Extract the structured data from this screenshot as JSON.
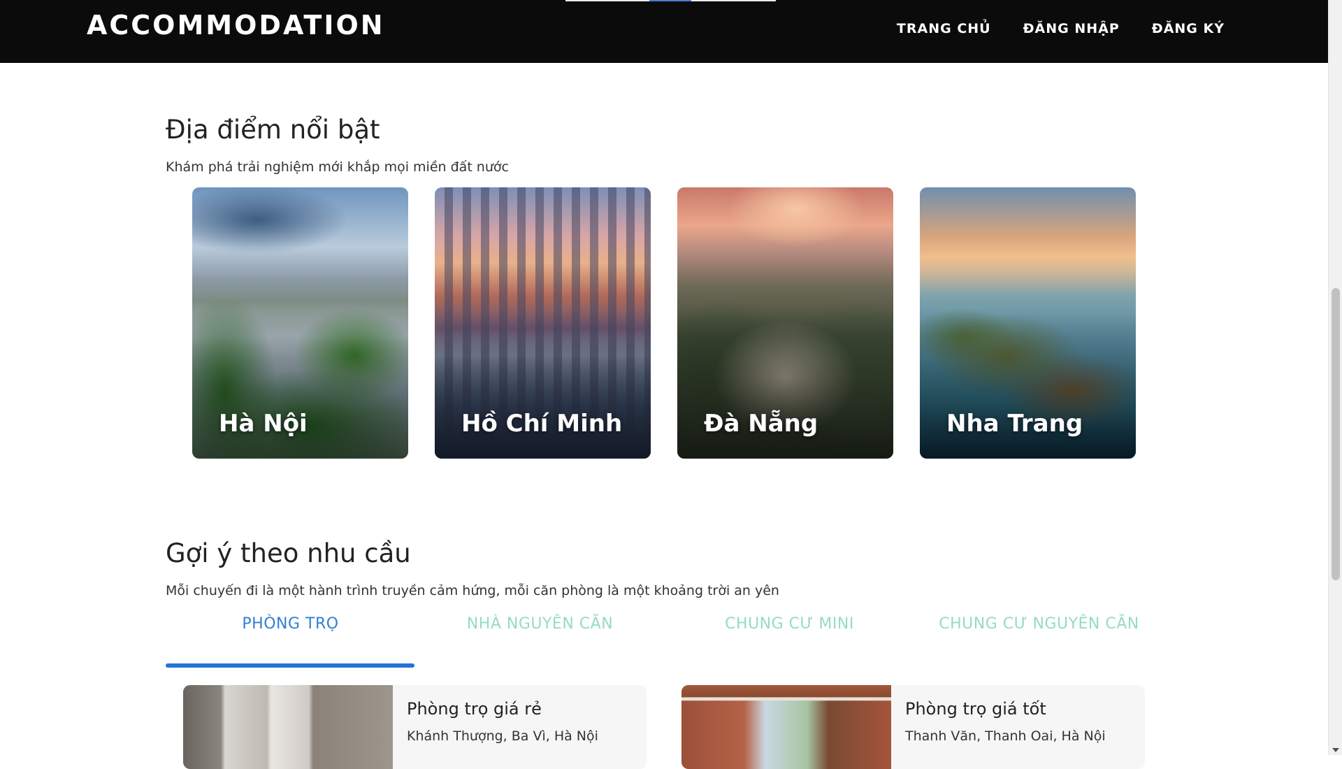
{
  "header": {
    "brand": "ACCOMMODATION",
    "nav": [
      {
        "label": "TRANG CHỦ"
      },
      {
        "label": "ĐĂNG NHẬP"
      },
      {
        "label": "ĐĂNG KÝ"
      }
    ]
  },
  "featured": {
    "title": "Địa điểm nổi bật",
    "subtitle": "Khám phá trải nghiệm mới khắp mọi miền đất nước",
    "destinations": [
      {
        "name": "Hà Nội"
      },
      {
        "name": "Hồ Chí Minh"
      },
      {
        "name": "Đà Nẵng"
      },
      {
        "name": "Nha Trang"
      }
    ]
  },
  "suggestions": {
    "title": "Gợi ý theo nhu cầu",
    "subtitle": "Mỗi chuyến đi là một hành trình truyền cảm hứng, mỗi căn phòng là một khoảng trời an yên",
    "tabs": [
      {
        "label": "PHÒNG TRỌ",
        "active": true
      },
      {
        "label": "NHÀ NGUYÊN CĂN",
        "active": false
      },
      {
        "label": "CHUNG CƯ MINI",
        "active": false
      },
      {
        "label": "CHUNG CƯ NGUYÊN CĂN",
        "active": false
      }
    ],
    "listings": [
      {
        "title": "Phòng trọ giá rẻ",
        "address": "Khánh Thượng, Ba Vì, Hà Nội"
      },
      {
        "title": "Phòng trọ giá tốt",
        "address": "Thanh Văn, Thanh Oai, Hà Nội"
      }
    ]
  },
  "colors": {
    "header_bg": "#0b0b0b",
    "tab_active": "#2f7fd6",
    "tab_inactive": "#95dcc0",
    "tab_underline": "#2473d8"
  }
}
